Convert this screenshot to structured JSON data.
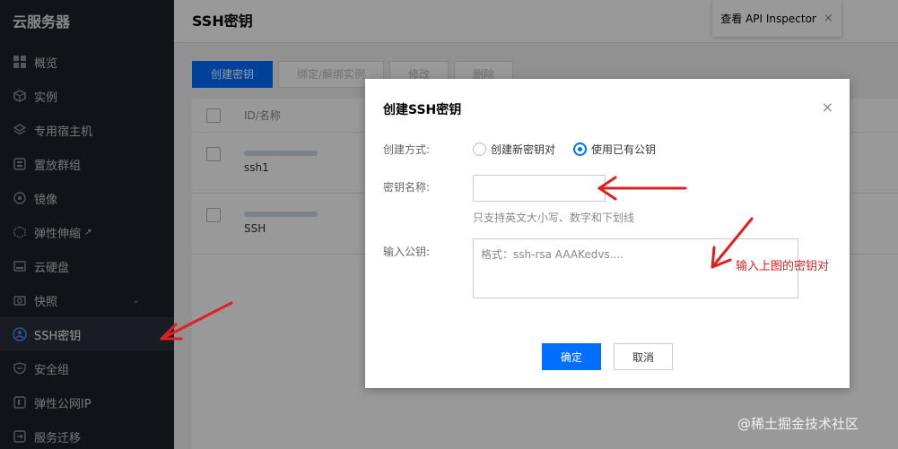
{
  "sidebar": {
    "title": "云服务器",
    "items": [
      {
        "label": "概览",
        "icon": "grid-icon"
      },
      {
        "label": "实例",
        "icon": "cube-icon"
      },
      {
        "label": "专用宿主机",
        "icon": "layers-icon"
      },
      {
        "label": "置放群组",
        "icon": "group-icon"
      },
      {
        "label": "镜像",
        "icon": "disc-icon"
      },
      {
        "label": "弹性伸缩",
        "icon": "scale-icon"
      },
      {
        "label": "云硬盘",
        "icon": "disk-icon"
      },
      {
        "label": "快照",
        "icon": "camera-icon"
      },
      {
        "label": "SSH密钥",
        "icon": "key-icon"
      },
      {
        "label": "安全组",
        "icon": "shield-icon"
      },
      {
        "label": "弹性公网IP",
        "icon": "ip-icon"
      },
      {
        "label": "服务迁移",
        "icon": "migrate-icon"
      }
    ]
  },
  "header": {
    "title": "SSH密钥"
  },
  "api_inspector": {
    "label": "查看 API Inspector",
    "close": "×"
  },
  "toolbar": {
    "create": "创建密钥",
    "bind": "绑定/解绑实例",
    "edit": "修改",
    "delete": "删除"
  },
  "table": {
    "header": "ID/名称",
    "rows": [
      {
        "name": "ssh1"
      },
      {
        "name": "SSH"
      }
    ]
  },
  "dialog": {
    "title": "创建SSH密钥",
    "close": "×",
    "method_label": "创建方式:",
    "option_new": "创建新密钥对",
    "option_existing": "使用已有公钥",
    "name_label": "密钥名称:",
    "name_value": "",
    "name_hint": "只支持英文大小写、数字和下划线",
    "pubkey_label": "输入公钥:",
    "pubkey_placeholder": "格式：ssh-rsa AAAKedvs....",
    "ok": "确定",
    "cancel": "取消"
  },
  "annotation": "输入上图的密钥对",
  "watermark": "@稀土掘金技术社区",
  "colors": {
    "accent": "#006eff",
    "sidebar_bg": "#1d2129",
    "annotation": "#e02020"
  }
}
